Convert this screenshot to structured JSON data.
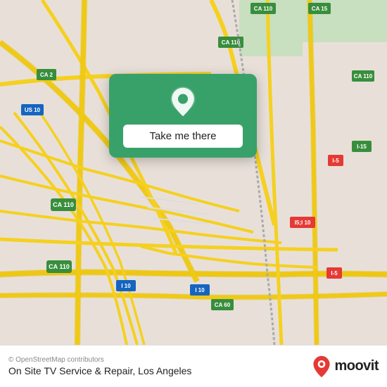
{
  "map": {
    "background_color": "#e8e0d8",
    "road_color": "#f5d020",
    "road_outline": "#e0b800"
  },
  "card": {
    "background": "#38a169",
    "button_label": "Take me there"
  },
  "footer": {
    "attribution": "© OpenStreetMap contributors",
    "location_name": "On Site TV Service & Repair, Los Angeles",
    "moovit_label": "moovit"
  }
}
